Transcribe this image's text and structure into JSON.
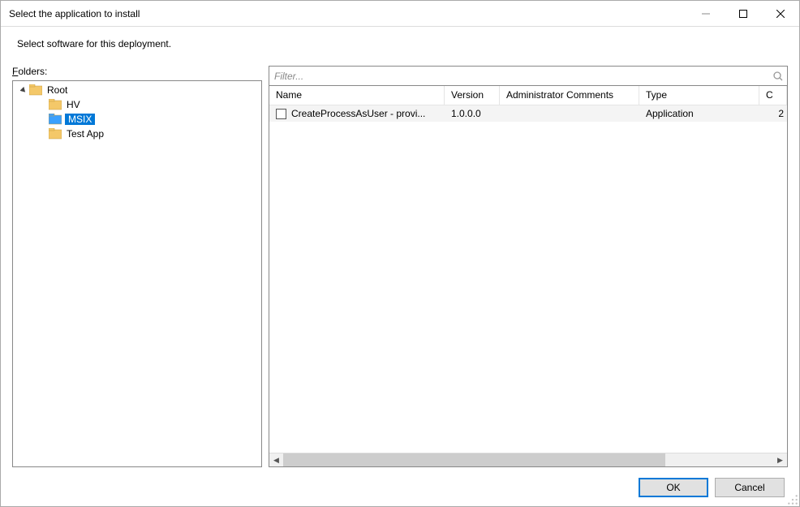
{
  "window": {
    "title": "Select the application to install"
  },
  "instruction": "Select software for this deployment.",
  "folders": {
    "label_prefix": "F",
    "label_rest": "olders:",
    "tree": {
      "root": "Root",
      "children": [
        "HV",
        "MSIX",
        "Test App"
      ],
      "selected": "MSIX"
    }
  },
  "filter": {
    "placeholder": "Filter..."
  },
  "list": {
    "columns": {
      "name": "Name",
      "version": "Version",
      "admin": "Administrator Comments",
      "type": "Type",
      "extra": "C"
    },
    "rows": [
      {
        "name": "CreateProcessAsUser - provi...",
        "version": "1.0.0.0",
        "admin": "",
        "type": "Application",
        "extra": "2"
      }
    ]
  },
  "buttons": {
    "ok": "OK",
    "cancel": "Cancel"
  }
}
